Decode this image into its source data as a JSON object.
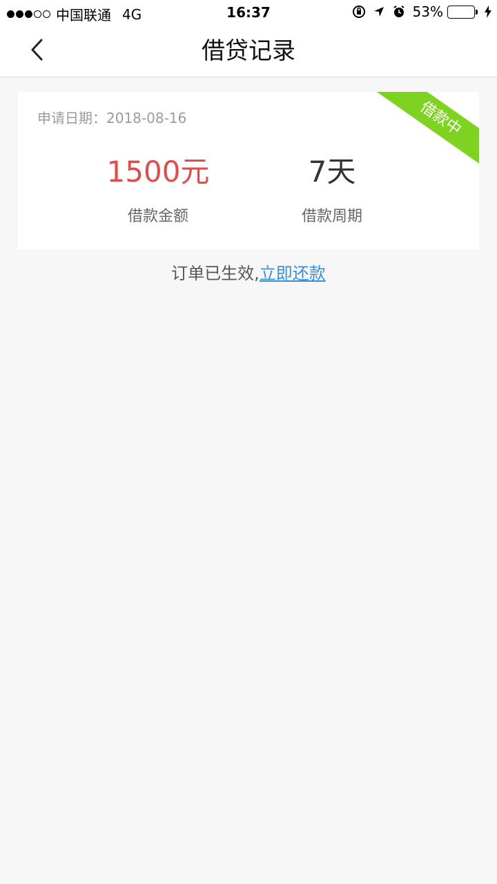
{
  "status_bar": {
    "carrier": "中国联通",
    "network": "4G",
    "time": "16:37",
    "battery": "53%",
    "battery_level": 0.53,
    "signal_bars_filled": 3,
    "signal_bars_total": 5,
    "icons": [
      "orientation-lock-icon",
      "location-arrow-icon",
      "alarm-icon",
      "charging-bolt-icon"
    ]
  },
  "nav": {
    "title": "借贷记录",
    "back_icon": "chevron-left-icon"
  },
  "card": {
    "apply_date": "申请日期：2018-08-16",
    "status_badge": "借款中",
    "amount_value": "1500元",
    "amount_label": "借款金额",
    "period_value": "7天",
    "period_label": "借款周期"
  },
  "footer": {
    "prefix": "订单已生效,",
    "link": "立即还款"
  },
  "colors": {
    "accent_red": "#e14b4b",
    "badge_green": "#7ed321",
    "link_blue": "#3a8fd9",
    "page_bg": "#f7f7f7"
  }
}
